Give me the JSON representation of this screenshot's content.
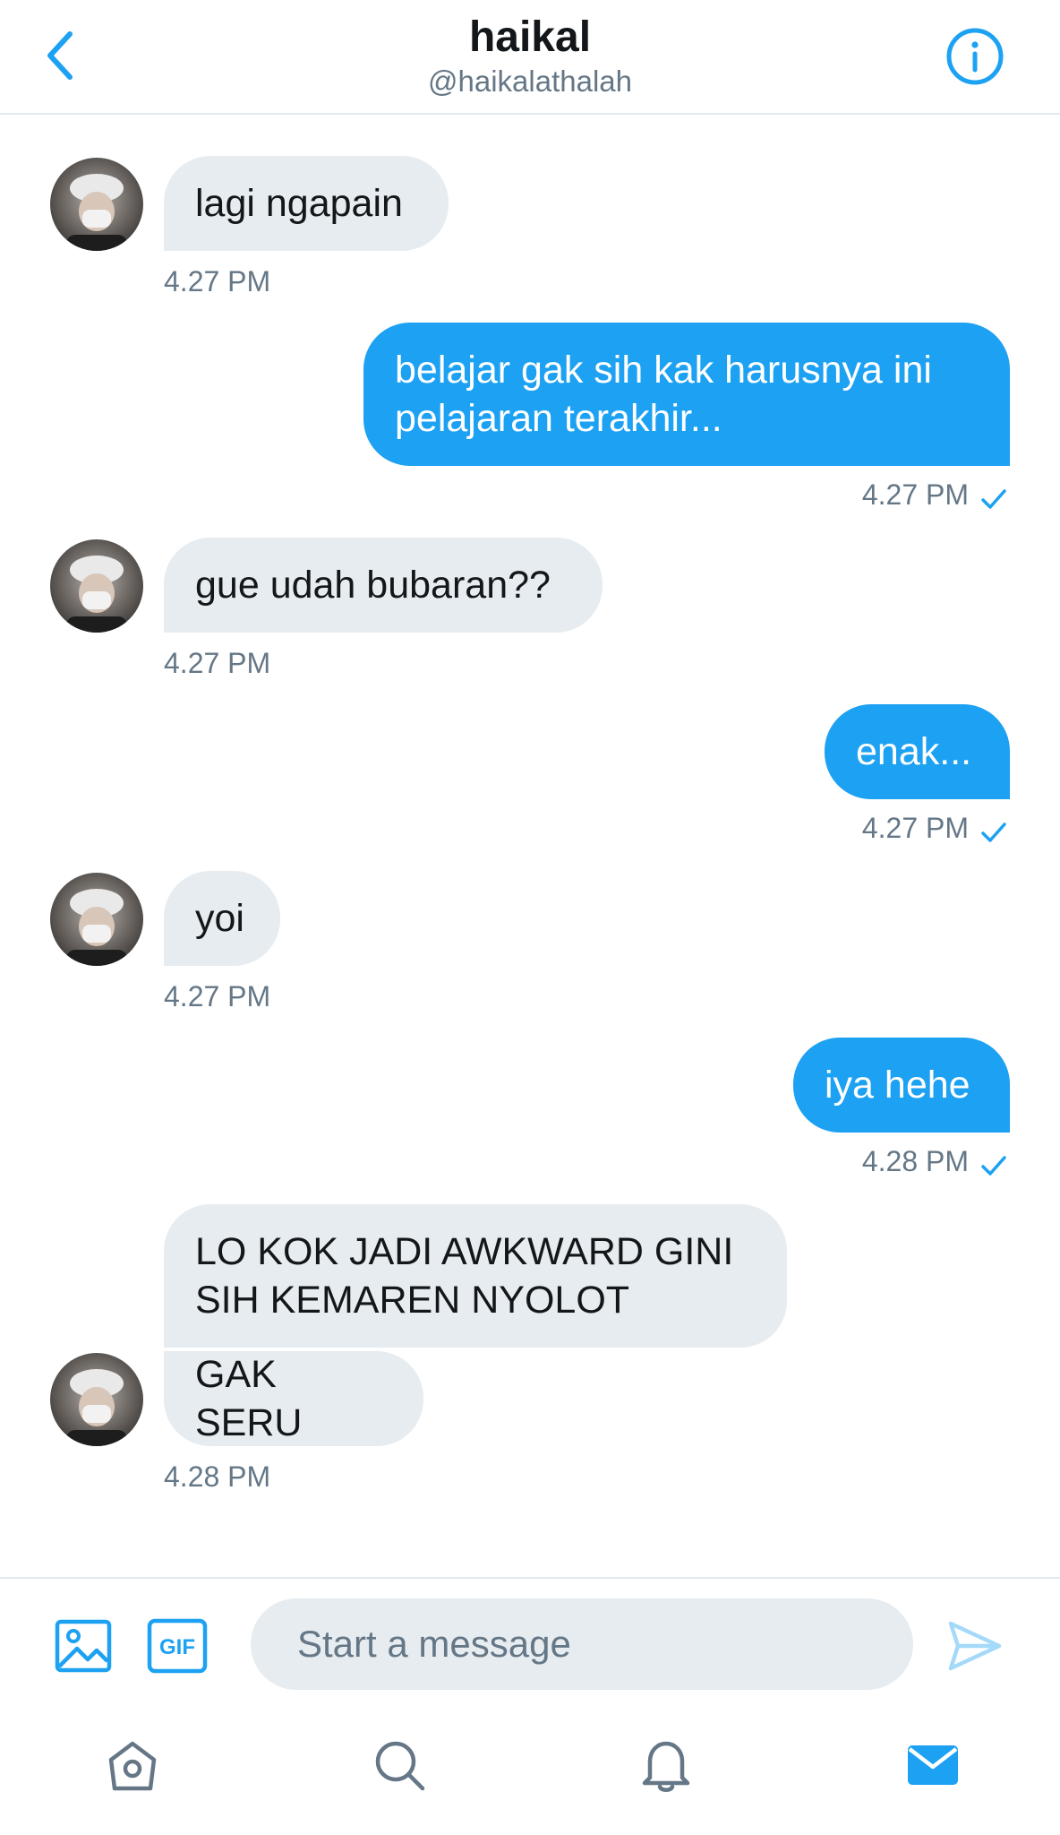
{
  "header": {
    "title": "haikal",
    "handle": "@haikalathalah",
    "back_icon": "chevron-left-icon",
    "info_icon": "info-icon"
  },
  "colors": {
    "accent": "#1da1f2",
    "incoming_bubble": "#e6ecf0",
    "secondary_text": "#657786",
    "divider": "#e1e8ed"
  },
  "messages": [
    {
      "direction": "incoming",
      "text": "lagi ngapain",
      "time": "4.27 PM"
    },
    {
      "direction": "outgoing",
      "text": "belajar gak sih kak harusnya ini\npelajaran terakhir...",
      "time": "4.27 PM",
      "status": "sent"
    },
    {
      "direction": "incoming",
      "text": "gue udah bubaran??",
      "time": "4.27 PM"
    },
    {
      "direction": "outgoing",
      "text": "enak...",
      "time": "4.27 PM",
      "status": "sent"
    },
    {
      "direction": "incoming",
      "text": "yoi",
      "time": "4.27 PM"
    },
    {
      "direction": "outgoing",
      "text": "iya hehe",
      "time": "4.28 PM",
      "status": "sent"
    },
    {
      "direction": "incoming",
      "text": "LO KOK JADI AWKWARD GINI\nSIH KEMAREN NYOLOT"
    },
    {
      "direction": "incoming",
      "text": "GAK SERU",
      "time": "4.28 PM"
    }
  ],
  "composer": {
    "placeholder": "Start a message",
    "value": "",
    "gif_label": "GIF",
    "image_icon": "image-icon",
    "send_icon": "send-icon"
  },
  "tabbar": {
    "items": [
      {
        "icon": "home-icon",
        "active": false
      },
      {
        "icon": "search-icon",
        "active": false
      },
      {
        "icon": "notifications-icon",
        "active": false
      },
      {
        "icon": "messages-icon",
        "active": true
      }
    ]
  }
}
